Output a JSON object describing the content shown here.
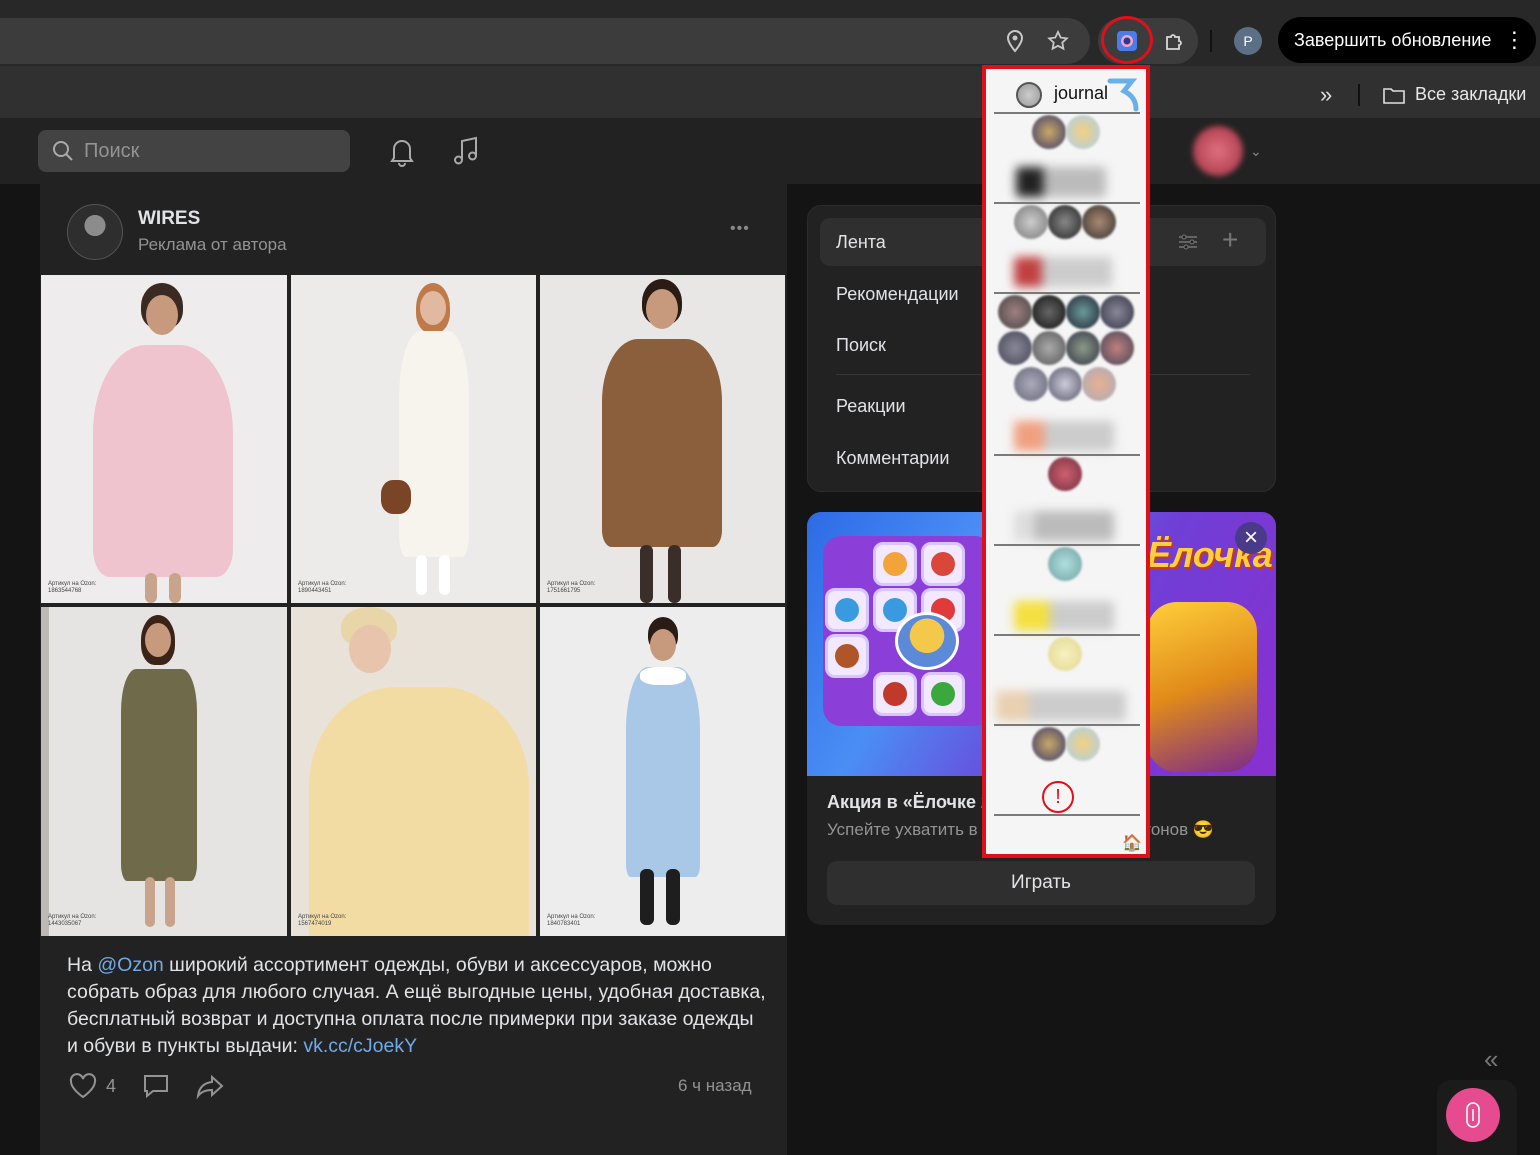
{
  "browser": {
    "update_button_label": "Завершить обновление",
    "profile_letter": "P",
    "bookmarks_overflow": "»",
    "all_bookmarks_label": "Все закладки"
  },
  "vk_header": {
    "search_placeholder": "Поиск"
  },
  "post": {
    "author": "WIRES",
    "subtitle": "Реклама от автора",
    "more": "•••",
    "photos": [
      {
        "article_label": "Артикул на Ozon:",
        "article_number": "1863544768"
      },
      {
        "article_label": "Артикул на Ozon:",
        "article_number": "1890443451"
      },
      {
        "article_label": "Артикул на Ozon:",
        "article_number": "1751661795"
      },
      {
        "article_label": "Артикул на Ozon:",
        "article_number": "1443035067"
      },
      {
        "article_label": "Артикул на Ozon:",
        "article_number": "1567474019"
      },
      {
        "article_label": "Артикул на Ozon:",
        "article_number": "1840783401"
      }
    ],
    "caption_prefix": "На ",
    "caption_mention": "@Ozon",
    "caption_body": " широкий ассортимент одежды, обуви и аксессуаров, можно собрать образ для любого случая. А ещё выгодные цены, удобная доставка, бесплатный возврат и доступна оплата после примерки при заказе одежды и обуви в пункты выдачи: ",
    "caption_link": "vk.cc/cJoekY",
    "likes": "4",
    "time": "6 ч назад"
  },
  "feed_menu": {
    "items": [
      "Лента",
      "Рекомендации",
      "Поиск",
      "Реакции",
      "Комментарии"
    ]
  },
  "ad": {
    "banner_title": "Ёлочка",
    "title": "Акция в «Ёлочке 2",
    "desc_left": "Успейте ухватить в",
    "desc_right": "гонов 😎",
    "play_label": "Играть",
    "close": "×"
  },
  "extension_popup": {
    "title": "journal",
    "error_mark": "!",
    "home_icon": "🏠"
  },
  "colors": {
    "highlight_red": "#e0101a",
    "link_blue": "#71aaeb",
    "accent_pink": "#e64a8f"
  }
}
